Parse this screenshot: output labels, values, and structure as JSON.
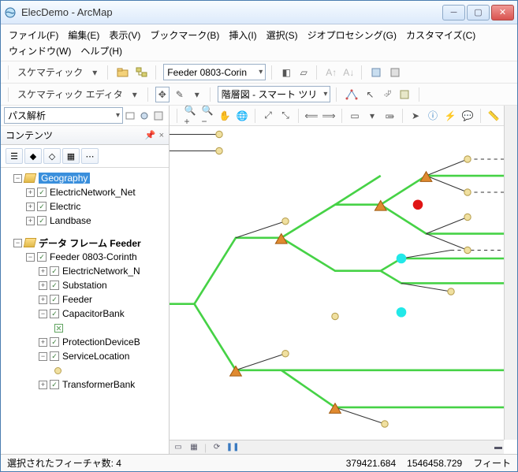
{
  "title": "ElecDemo - ArcMap",
  "menu": [
    "ファイル(F)",
    "編集(E)",
    "表示(V)",
    "ブックマーク(B)",
    "挿入(I)",
    "選択(S)",
    "ジオプロセシング(G)",
    "カスタマイズ(C)",
    "ウィンドウ(W)",
    "ヘルプ(H)"
  ],
  "tb1": {
    "label": "スケマティック",
    "feeder_dd": "Feeder 0803-Corin"
  },
  "tb2": {
    "label": "スケマティック エディタ",
    "layout_dd": "階層図 - スマート ツリ"
  },
  "na": {
    "dd": "パス解析"
  },
  "toc": {
    "title": "コンテンツ",
    "root1": "Geography",
    "root1_children": [
      "ElectricNetwork_Net",
      "Electric",
      "Landbase"
    ],
    "root2": "データ フレーム Feeder",
    "feeder": "Feeder 0803-Corinth",
    "layers": [
      "ElectricNetwork_N",
      "Substation",
      "Feeder",
      "CapacitorBank",
      "ProtectionDeviceB",
      "ServiceLocation",
      "TransformerBank"
    ]
  },
  "status": {
    "selected": "選択されたフィーチャ数: 4",
    "x": "379421.684",
    "y": "1546458.729",
    "unit": "フィート"
  }
}
